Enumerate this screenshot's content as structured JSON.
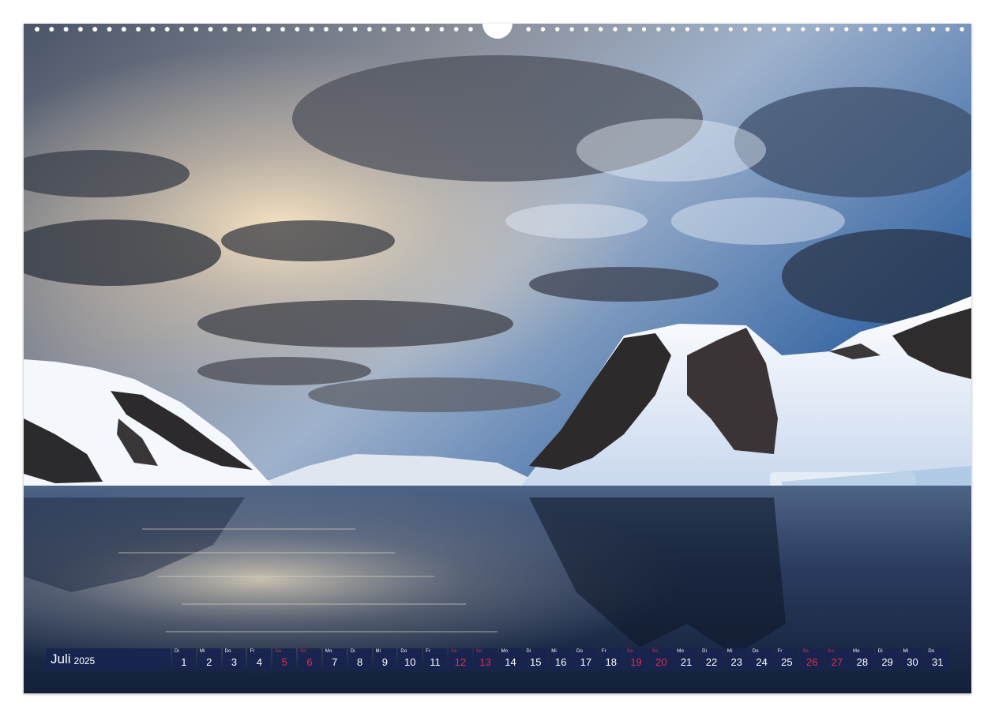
{
  "calendar": {
    "month": "Juli",
    "year": "2025",
    "days": [
      {
        "dow": "Di",
        "num": "1",
        "weekend": false
      },
      {
        "dow": "Mi",
        "num": "2",
        "weekend": false
      },
      {
        "dow": "Do",
        "num": "3",
        "weekend": false
      },
      {
        "dow": "Fr",
        "num": "4",
        "weekend": false
      },
      {
        "dow": "Sa",
        "num": "5",
        "weekend": true
      },
      {
        "dow": "So",
        "num": "6",
        "weekend": true
      },
      {
        "dow": "Mo",
        "num": "7",
        "weekend": false
      },
      {
        "dow": "Di",
        "num": "8",
        "weekend": false
      },
      {
        "dow": "Mi",
        "num": "9",
        "weekend": false
      },
      {
        "dow": "Do",
        "num": "10",
        "weekend": false
      },
      {
        "dow": "Fr",
        "num": "11",
        "weekend": false
      },
      {
        "dow": "Sa",
        "num": "12",
        "weekend": true
      },
      {
        "dow": "So",
        "num": "13",
        "weekend": true
      },
      {
        "dow": "Mo",
        "num": "14",
        "weekend": false
      },
      {
        "dow": "Di",
        "num": "15",
        "weekend": false
      },
      {
        "dow": "Mi",
        "num": "16",
        "weekend": false
      },
      {
        "dow": "Do",
        "num": "17",
        "weekend": false
      },
      {
        "dow": "Fr",
        "num": "18",
        "weekend": false
      },
      {
        "dow": "Sa",
        "num": "19",
        "weekend": true
      },
      {
        "dow": "So",
        "num": "20",
        "weekend": true
      },
      {
        "dow": "Mo",
        "num": "21",
        "weekend": false
      },
      {
        "dow": "Di",
        "num": "22",
        "weekend": false
      },
      {
        "dow": "Mi",
        "num": "23",
        "weekend": false
      },
      {
        "dow": "Do",
        "num": "24",
        "weekend": false
      },
      {
        "dow": "Fr",
        "num": "25",
        "weekend": false
      },
      {
        "dow": "Sa",
        "num": "26",
        "weekend": true
      },
      {
        "dow": "So",
        "num": "27",
        "weekend": true
      },
      {
        "dow": "Mo",
        "num": "28",
        "weekend": false
      },
      {
        "dow": "Di",
        "num": "29",
        "weekend": false
      },
      {
        "dow": "Mi",
        "num": "30",
        "weekend": false
      },
      {
        "dow": "Do",
        "num": "31",
        "weekend": false
      }
    ]
  },
  "colors": {
    "bar": "#18244e",
    "weekend": "#e0304a",
    "weekday": "#ffffff"
  },
  "photo": {
    "subject": "antarctic-fjord-photo"
  }
}
